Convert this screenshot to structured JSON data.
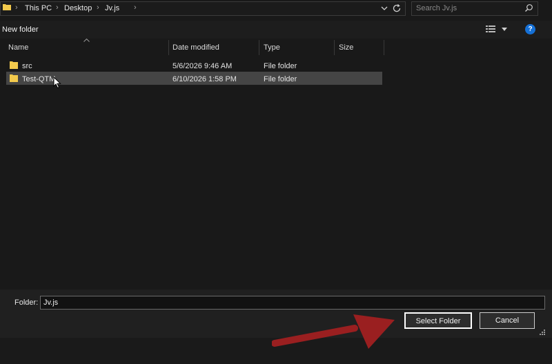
{
  "address_bar": {
    "breadcrumbs": [
      "This PC",
      "Desktop",
      "Jv.js"
    ]
  },
  "search": {
    "placeholder": "Search Jv.js"
  },
  "toolbar": {
    "new_folder_label": "New folder",
    "help_label": "?"
  },
  "columns": [
    "Name",
    "Date modified",
    "Type",
    "Size"
  ],
  "files": [
    {
      "name": "src",
      "date_modified": "5/6/2026 9:46 AM",
      "type": "File folder",
      "size": ""
    },
    {
      "name": "Test-QTM",
      "date_modified": "6/10/2026 1:58 PM",
      "type": "File folder",
      "size": ""
    }
  ],
  "selected_index": 1,
  "footer": {
    "folder_label": "Folder:",
    "folder_value": "Jv.js",
    "select_button": "Select Folder",
    "cancel_button": "Cancel"
  },
  "colors": {
    "background": "#191919",
    "folder_icon": "#f2c94c",
    "accent_blue": "#1570d6",
    "annotation_arrow": "#9a1f20"
  },
  "icons": [
    "folder-icon",
    "chevron-right-icon",
    "chevron-down-icon",
    "refresh-icon",
    "search-icon",
    "view-options-icon",
    "help-icon",
    "mouse-cursor-icon",
    "resize-grip-icon",
    "red-annotation-arrow"
  ]
}
